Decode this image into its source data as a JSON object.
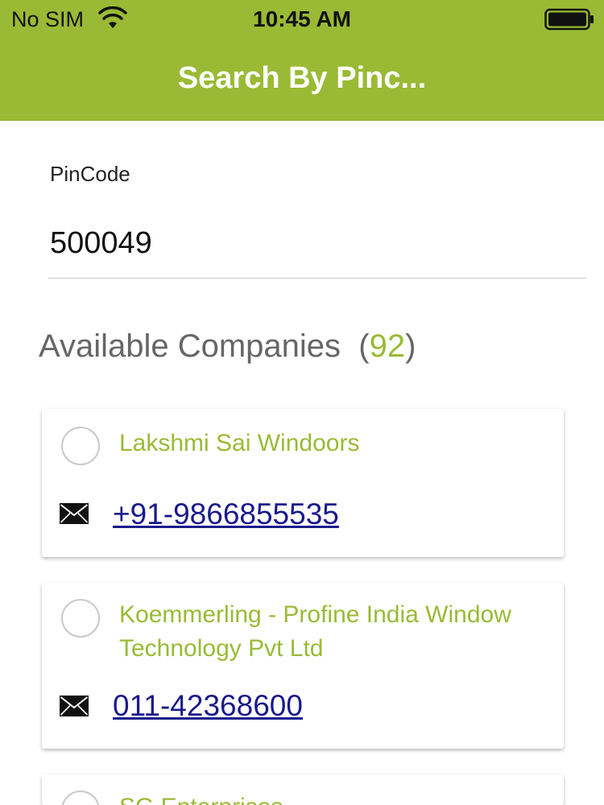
{
  "status_bar": {
    "carrier": "No SIM",
    "time": "10:45 AM",
    "wifi_icon": "wifi-icon",
    "battery_icon": "battery-icon"
  },
  "nav": {
    "title": "Search By Pinc...",
    "background_color": "#9aba35"
  },
  "pincode": {
    "label": "PinCode",
    "value": "500049"
  },
  "section": {
    "title": "Available Companies",
    "open_paren": "(",
    "count": "92",
    "close_paren": ")"
  },
  "companies": [
    {
      "name": "Lakshmi Sai Windoors",
      "phone": "+91-9866855535"
    },
    {
      "name": "Koemmerling - Profine India Window Technology Pvt Ltd",
      "phone": "011-42368600"
    },
    {
      "name": "SG Enterprises",
      "phone": ""
    }
  ],
  "colors": {
    "accent": "#9aba35",
    "link": "#1a1a8c",
    "section_title": "#666666"
  }
}
